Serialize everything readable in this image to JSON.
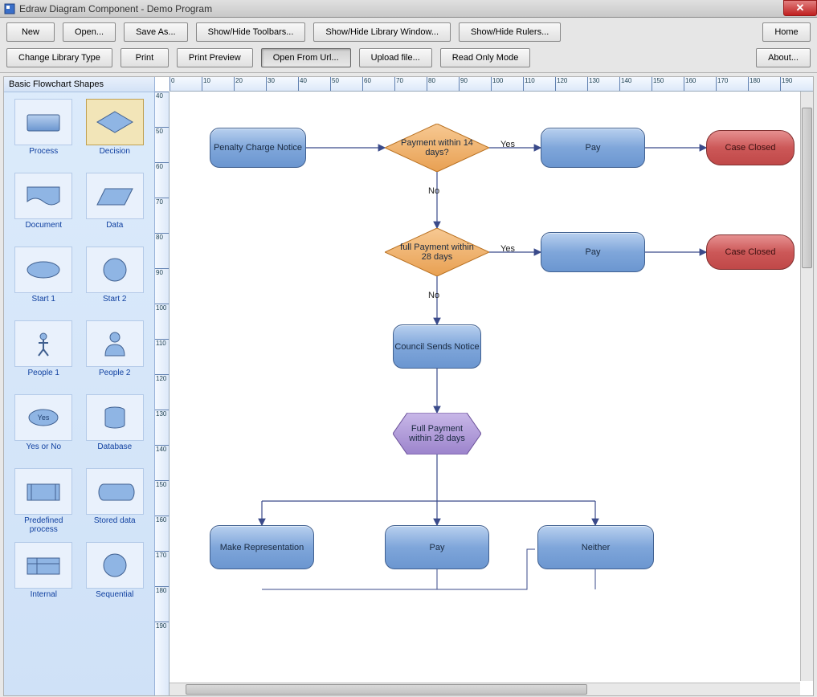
{
  "window": {
    "title": "Edraw Diagram Component - Demo Program"
  },
  "toolbar1": {
    "new": "New",
    "open": "Open...",
    "saveas": "Save As...",
    "showhide_toolbars": "Show/Hide Toolbars...",
    "showhide_library": "Show/Hide Library Window...",
    "showhide_rulers": "Show/Hide Rulers...",
    "home": "Home"
  },
  "toolbar2": {
    "change_library": "Change Library Type",
    "print": "Print",
    "print_preview": "Print Preview",
    "open_from_url": "Open From Url...",
    "upload_file": "Upload file...",
    "readonly": "Read Only Mode",
    "about": "About..."
  },
  "shapes_panel": {
    "title": "Basic Flowchart Shapes",
    "items": [
      {
        "label": "Process"
      },
      {
        "label": "Decision"
      },
      {
        "label": "Document"
      },
      {
        "label": "Data"
      },
      {
        "label": "Start 1"
      },
      {
        "label": "Start 2"
      },
      {
        "label": "People 1"
      },
      {
        "label": "People 2"
      },
      {
        "label": "Yes or No"
      },
      {
        "label": "Database"
      },
      {
        "label": "Predefined process"
      },
      {
        "label": "Stored data"
      },
      {
        "label": "Internal"
      },
      {
        "label": "Sequential"
      }
    ],
    "yes_badge": "Yes"
  },
  "diagram": {
    "nodes": {
      "n1": "Penalty Charge Notice",
      "n2": "Payment within 14 days?",
      "n3": "Pay",
      "n4": "Case Closed",
      "n5": "full Payment within 28 days",
      "n6": "Pay",
      "n7": "Case Closed",
      "n8": "Council Sends Notice",
      "n9": "Full Payment within 28 days",
      "n10": "Make Representation",
      "n11": "Pay",
      "n12": "Neither"
    },
    "edge_labels": {
      "yes1": "Yes",
      "no1": "No",
      "yes2": "Yes",
      "no2": "No"
    }
  },
  "ruler_h": [
    "0",
    "10",
    "20",
    "30",
    "40",
    "50",
    "60",
    "70",
    "80",
    "90",
    "100",
    "110",
    "120",
    "130",
    "140",
    "150",
    "160",
    "170",
    "180",
    "190"
  ],
  "ruler_v": [
    "40",
    "50",
    "60",
    "70",
    "80",
    "90",
    "100",
    "110",
    "120",
    "130",
    "140",
    "150",
    "160",
    "170",
    "180",
    "190"
  ]
}
